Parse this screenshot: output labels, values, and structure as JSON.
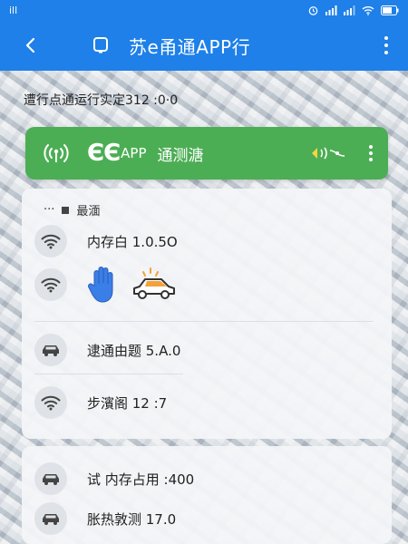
{
  "status_bar": {
    "left_text": "ill",
    "right_icons": [
      "alarm-icon",
      "signal-icon",
      "signal-icon-2",
      "wifi-icon",
      "battery-icon"
    ]
  },
  "app_bar": {
    "title": "苏e甬通APP行",
    "icons": [
      "back-icon",
      "tablet-icon",
      "more-vert-icon"
    ]
  },
  "info_line": "遭行点通运行实定312 :0·0",
  "banner": {
    "logo": "ЄЄ",
    "app": "APP",
    "title": "通测溏",
    "color": "#4cae54"
  },
  "section": {
    "prefix": "···",
    "title": "最湎"
  },
  "rows": [
    {
      "icon": "wifi-icon",
      "label": "内存白 1.0.5O"
    },
    {
      "icon": "wifi-icon",
      "label": "",
      "extra_icons": [
        "hand-icon",
        "car-icon"
      ]
    },
    {
      "icon": "car-icon",
      "label": "逮通由题 5.A.0"
    },
    {
      "icon": "wifi-icon",
      "label": "步濱阁 12 :7"
    },
    {
      "icon": "car-icon",
      "label": "试 内存占用 :400"
    },
    {
      "icon": "car-icon",
      "label": "胀热敦测 17.0"
    }
  ],
  "colors": {
    "primary": "#1e80e8",
    "banner_green": "#4cae54",
    "hand_blue": "#3a7ee8",
    "car_orange": "#f2a23a"
  }
}
